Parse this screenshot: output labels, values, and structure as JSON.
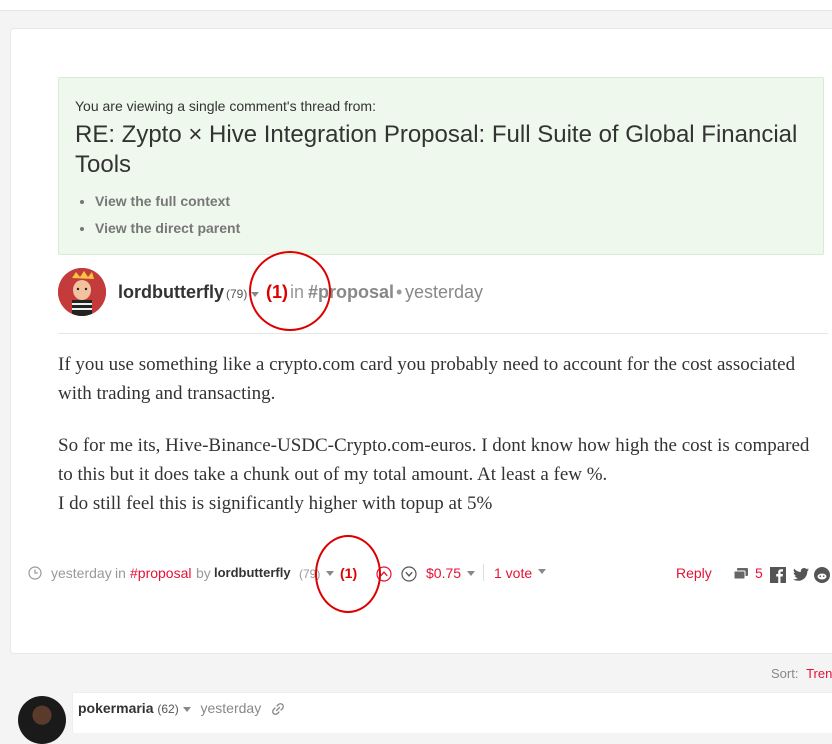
{
  "context_box": {
    "intro": "You are viewing a single comment's thread from:",
    "title": "RE: Zypto × Hive Integration Proposal: Full Suite of Global Financial Tools",
    "links": [
      "View the full context",
      "View the direct parent"
    ]
  },
  "comment": {
    "author": "lordbutterfly",
    "reputation": "(79)",
    "annotation": "(1)",
    "in_label": "in",
    "tag": "#proposal",
    "separator": "•",
    "time": "yesterday",
    "paragraphs": [
      "If you use something like a crypto.com card you probably need to account for the cost associated with trading and transacting.",
      "So for me its, Hive-Binance-USDC-Crypto.com-euros. I dont know how high the cost is compared to this but it does take a chunk out of my total amount. At least a few %.",
      "I do still feel this is significantly higher with topup at 5%"
    ]
  },
  "footer": {
    "time": "yesterday",
    "in_label": "in",
    "tag": "#proposal",
    "by_label": "by",
    "author": "lordbutterfly",
    "reputation": "(79)",
    "annotation": "(1)",
    "payout": "$0.75",
    "votes": "1 vote",
    "reply_label": "Reply",
    "comment_count": "5"
  },
  "sort": {
    "label": "Sort:",
    "value": "Tren"
  },
  "reply": {
    "author": "pokermaria",
    "reputation": "(62)",
    "time": "yesterday"
  },
  "colors": {
    "accent": "#e31337",
    "annotation": "#dd0000",
    "context_bg": "#eef8ec"
  }
}
